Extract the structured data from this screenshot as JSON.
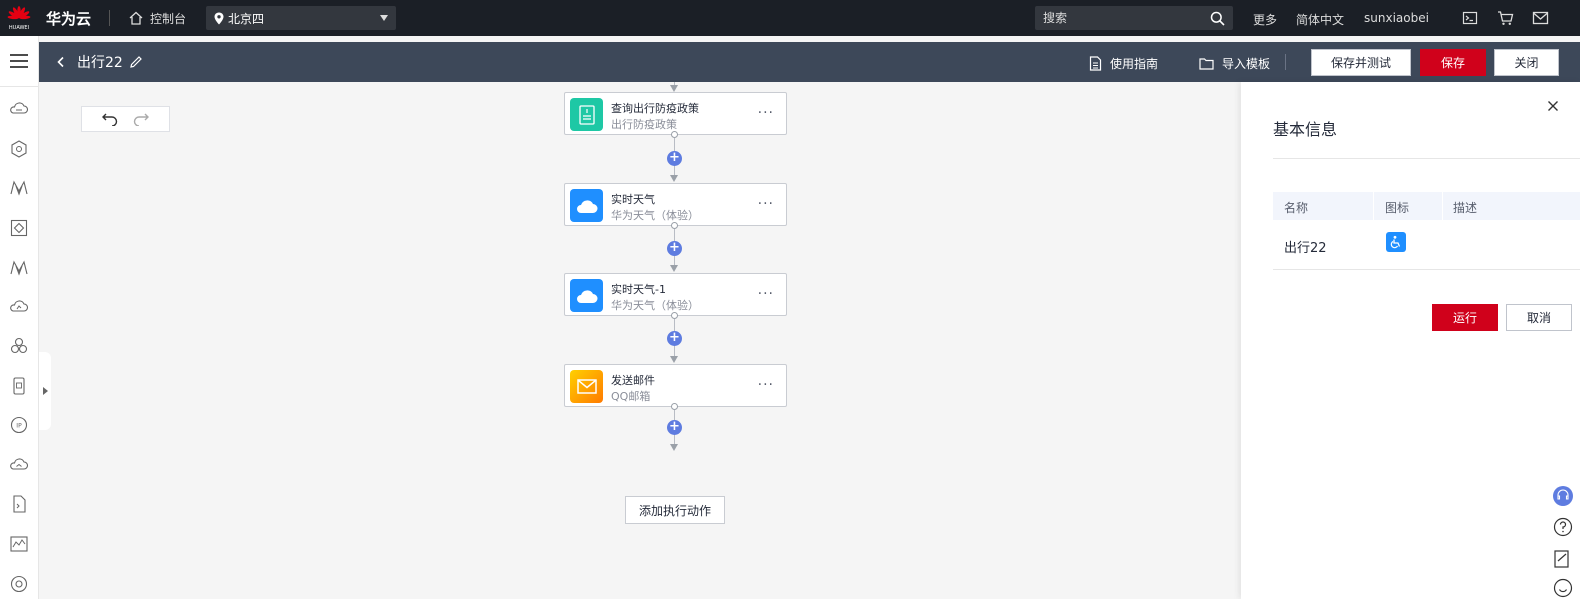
{
  "topbar": {
    "logo_text": "HUAWEI",
    "brand": "华为云",
    "console": "控制台",
    "region": "北京四",
    "search_placeholder": "搜索",
    "more": "更多",
    "language": "简体中文",
    "user": "sunxiaobei"
  },
  "subheader": {
    "title": "出行22",
    "guide": "使用指南",
    "import_template": "导入模板",
    "save_and_test": "保存并测试",
    "save": "保存",
    "close": "关闭"
  },
  "canvas": {
    "nodes": [
      {
        "title": "查询出行防疫政策",
        "subtitle": "出行防疫政策",
        "more": "···",
        "icon": "document-icon",
        "color": "#1ec8a5"
      },
      {
        "title": "实时天气",
        "subtitle": "华为天气（体验）",
        "more": "···",
        "icon": "cloud-icon",
        "color": "#1f8fff"
      },
      {
        "title": "实时天气-1",
        "subtitle": "华为天气（体验）",
        "more": "···",
        "icon": "cloud-icon",
        "color": "#1f8fff"
      },
      {
        "title": "发送邮件",
        "subtitle": "QQ邮箱",
        "more": "···",
        "icon": "mail-icon",
        "color": "#ff9f00"
      }
    ],
    "plus_label": "+",
    "add_action": "添加执行动作"
  },
  "panel": {
    "title": "基本信息",
    "columns": [
      "名称",
      "图标",
      "描述"
    ],
    "row": {
      "name": "出行22",
      "icon": "accessibility-icon",
      "description": ""
    },
    "run": "运行",
    "cancel": "取消"
  },
  "colors": {
    "topbar": "#1b1f26",
    "subheader": "#3d4859",
    "primary_red": "#d0011b",
    "plus_blue": "#5e7ce0"
  }
}
